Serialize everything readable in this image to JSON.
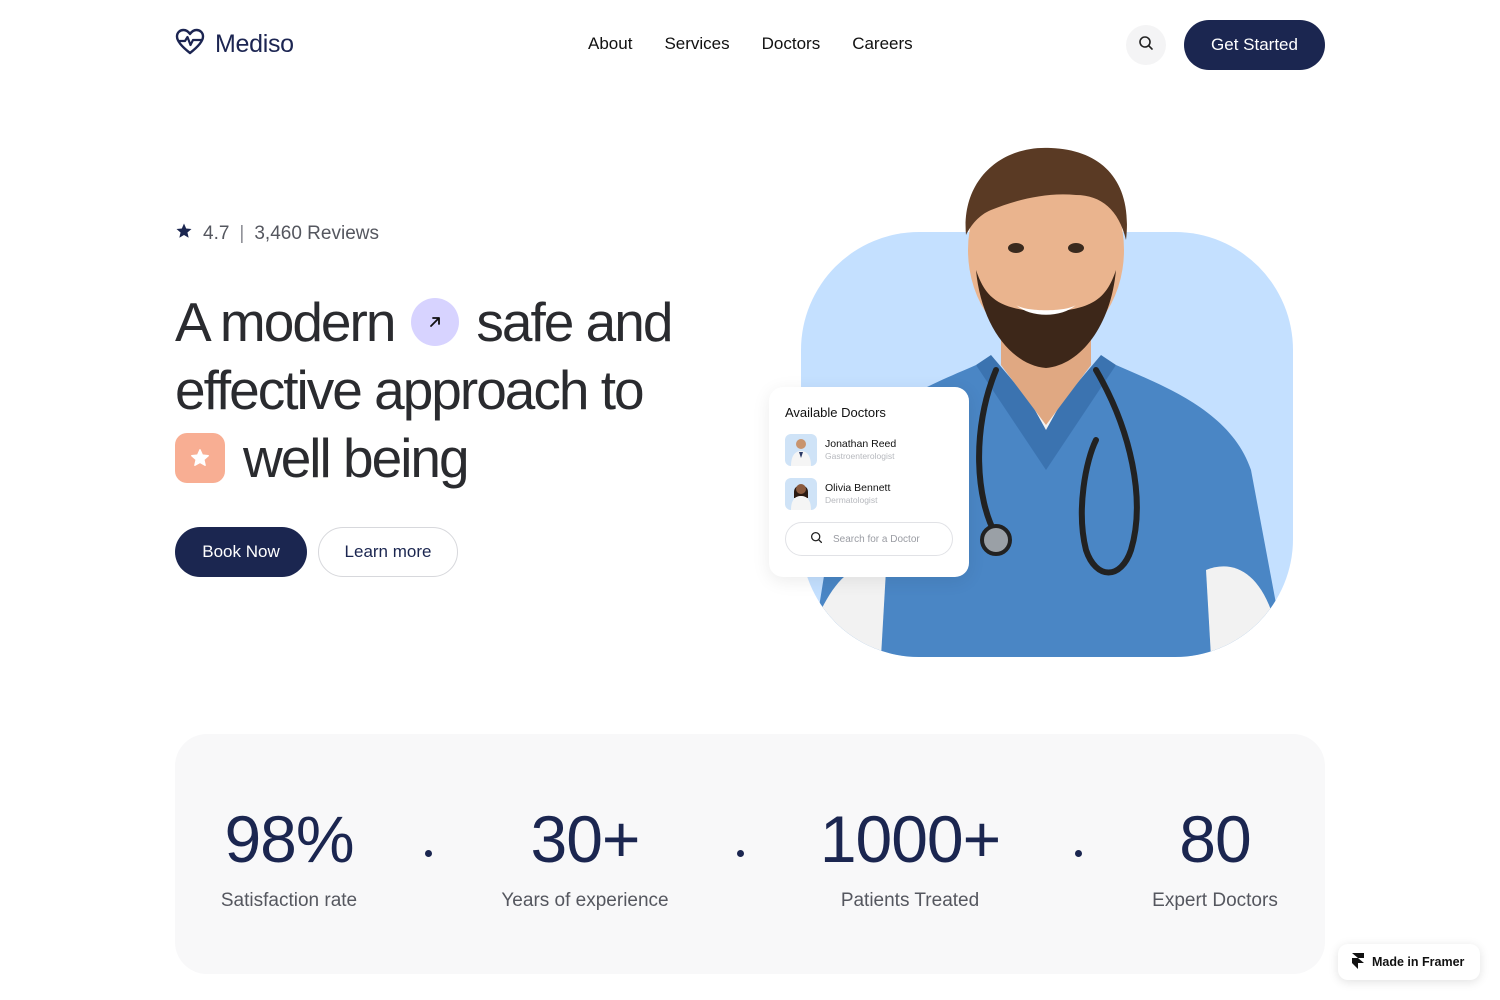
{
  "header": {
    "brand": "Mediso",
    "nav": [
      "About",
      "Services",
      "Doctors",
      "Careers"
    ],
    "search_icon": "search-icon",
    "cta": "Get Started"
  },
  "hero": {
    "rating_value": "4.7",
    "rating_separator": "|",
    "reviews": "3,460 Reviews",
    "headline": {
      "line1_a": "A modern",
      "line1_b": "safe and",
      "line2": "effective approach to",
      "line3": "well being"
    },
    "primary_button": "Book Now",
    "secondary_button": "Learn more"
  },
  "doctors_card": {
    "title": "Available Doctors",
    "doctors": [
      {
        "name": "Jonathan Reed",
        "specialty": "Gastroenterologist"
      },
      {
        "name": "Olivia Bennett",
        "specialty": "Dermatologist"
      }
    ],
    "search_placeholder": "Search for a Doctor"
  },
  "stats": [
    {
      "value": "98%",
      "label": "Satisfaction rate"
    },
    {
      "value": "30+",
      "label": "Years of experience"
    },
    {
      "value": "1000+",
      "label": "Patients Treated"
    },
    {
      "value": "80",
      "label": "Expert Doctors"
    }
  ],
  "badge": {
    "label": "Made in Framer"
  },
  "colors": {
    "navy": "#1b2650",
    "hero_blue": "#c4e0ff",
    "lavender": "#d7d3ff",
    "peach": "#f8ae93"
  }
}
